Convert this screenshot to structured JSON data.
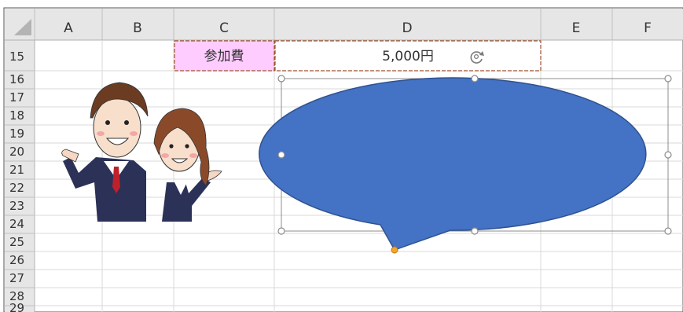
{
  "sheet": {
    "columns": [
      "A",
      "B",
      "C",
      "D",
      "E",
      "F"
    ],
    "rows": [
      "15",
      "16",
      "17",
      "18",
      "19",
      "20",
      "21",
      "22",
      "23",
      "24",
      "25",
      "26",
      "27",
      "28",
      "29"
    ],
    "cells": {
      "c15": "参加費",
      "d15": "5,000円"
    }
  },
  "colors": {
    "header_bg": "#e6e6e6",
    "label_cell_bg": "#ffccff",
    "callout_fill": "#4472c4",
    "callout_stroke": "#2f528f",
    "cell_border": "#a0522d",
    "grid": "#d9d9d9"
  },
  "icons": {
    "rotate_handle": "rotate-icon",
    "clipart": "business-people-illustration"
  }
}
